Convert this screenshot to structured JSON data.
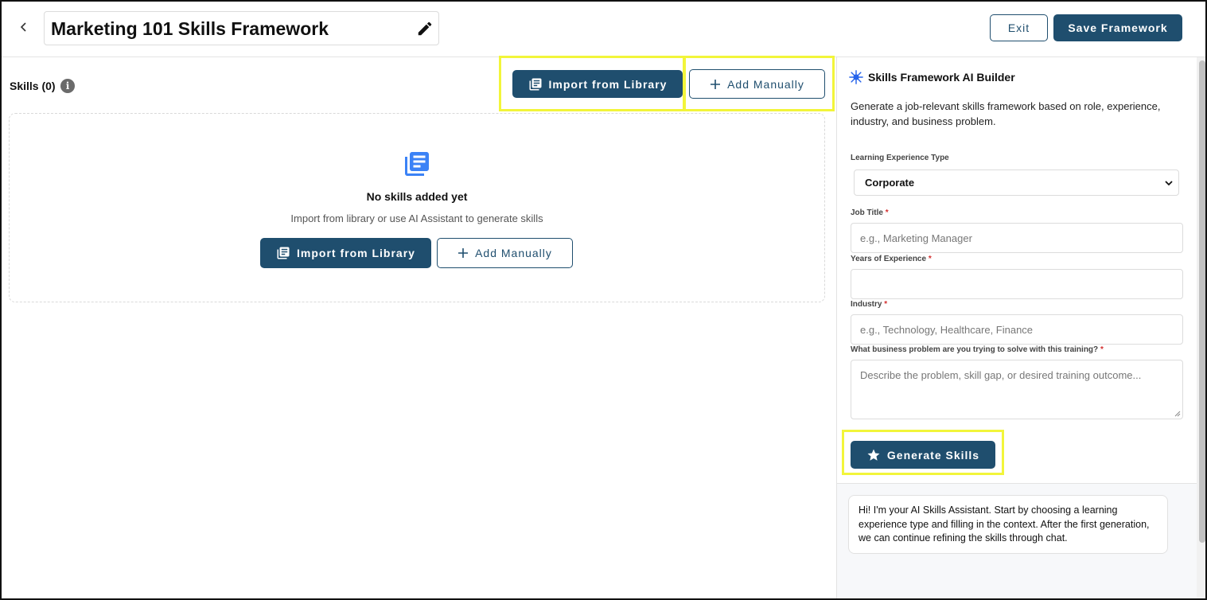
{
  "header": {
    "back_icon": "chevron-left-icon",
    "title": "Marketing 101 Skills Framework",
    "edit_icon": "pencil-icon",
    "exit_label": "Exit",
    "save_label": "Save Framework"
  },
  "skills": {
    "label": "Skills (0)",
    "info_icon": "i",
    "import_label": "Import from Library",
    "add_label": "Add Manually",
    "empty": {
      "title": "No skills added yet",
      "subtitle": "Import from library or use AI Assistant to generate skills",
      "import_label": "Import from Library",
      "add_label": "Add Manually"
    }
  },
  "ai_builder": {
    "title": "Skills Framework AI Builder",
    "description": "Generate a job-relevant skills framework based on role, experience, industry, and business problem.",
    "learning_type_label": "Learning Experience Type",
    "learning_type_value": "Corporate",
    "job_title_label": "Job Title",
    "job_title_placeholder": "e.g., Marketing Manager",
    "years_label": "Years of Experience",
    "years_value": "",
    "industry_label": "Industry",
    "industry_placeholder": "e.g., Technology, Healthcare, Finance",
    "problem_label": "What business problem are you trying to solve with this training?",
    "problem_placeholder": "Describe the problem, skill gap, or desired training outcome...",
    "required_mark": "*",
    "generate_label": "Generate Skills"
  },
  "chat": {
    "message": "Hi! I'm your AI Skills Assistant. Start by choosing a learning experience type and filling in the context. After the first generation, we can continue refining the skills through chat."
  },
  "colors": {
    "primary": "#1f4e6e",
    "highlight": "#f2f53a",
    "ai_icon": "#2563eb",
    "empty_icon": "#3b82f6"
  }
}
